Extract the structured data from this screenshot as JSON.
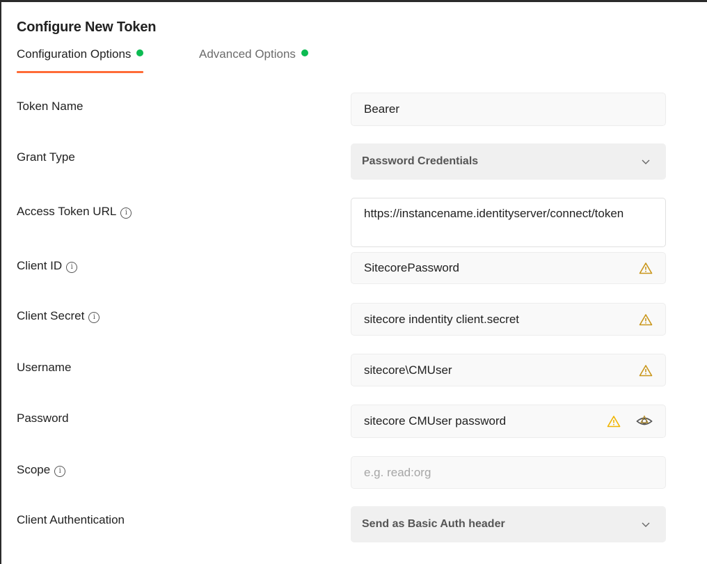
{
  "dialog": {
    "title": "Configure New Token",
    "tabs": [
      {
        "label": "Configuration Options",
        "active": true,
        "status_dot": "green"
      },
      {
        "label": "Advanced Options",
        "active": false,
        "status_dot": "green"
      }
    ]
  },
  "colors": {
    "accent": "#ff6c37",
    "status_dot": "#0cbb52",
    "warning": "#e5a50a"
  },
  "form": {
    "token_name": {
      "label": "Token Name",
      "value": "Bearer"
    },
    "grant_type": {
      "label": "Grant Type",
      "value": "Password Credentials"
    },
    "access_token_url": {
      "label": "Access Token URL",
      "value": "https://instancename.identityserver/connect/token",
      "has_info": true
    },
    "client_id": {
      "label": "Client ID",
      "value": "SitecorePassword",
      "has_info": true,
      "warning": true
    },
    "client_secret": {
      "label": "Client Secret",
      "value": "sitecore indentity client.secret",
      "has_info": true,
      "warning": true
    },
    "username": {
      "label": "Username",
      "value": "sitecore\\CMUser",
      "warning": true
    },
    "password": {
      "label": "Password",
      "value": "sitecore CMUser password",
      "warning": true,
      "reveal_icon": "eye-icon"
    },
    "scope": {
      "label": "Scope",
      "value": "",
      "placeholder": "e.g. read:org",
      "has_info": true
    },
    "client_authentication": {
      "label": "Client Authentication",
      "value": "Send as Basic Auth header"
    }
  },
  "info_glyph": "i"
}
